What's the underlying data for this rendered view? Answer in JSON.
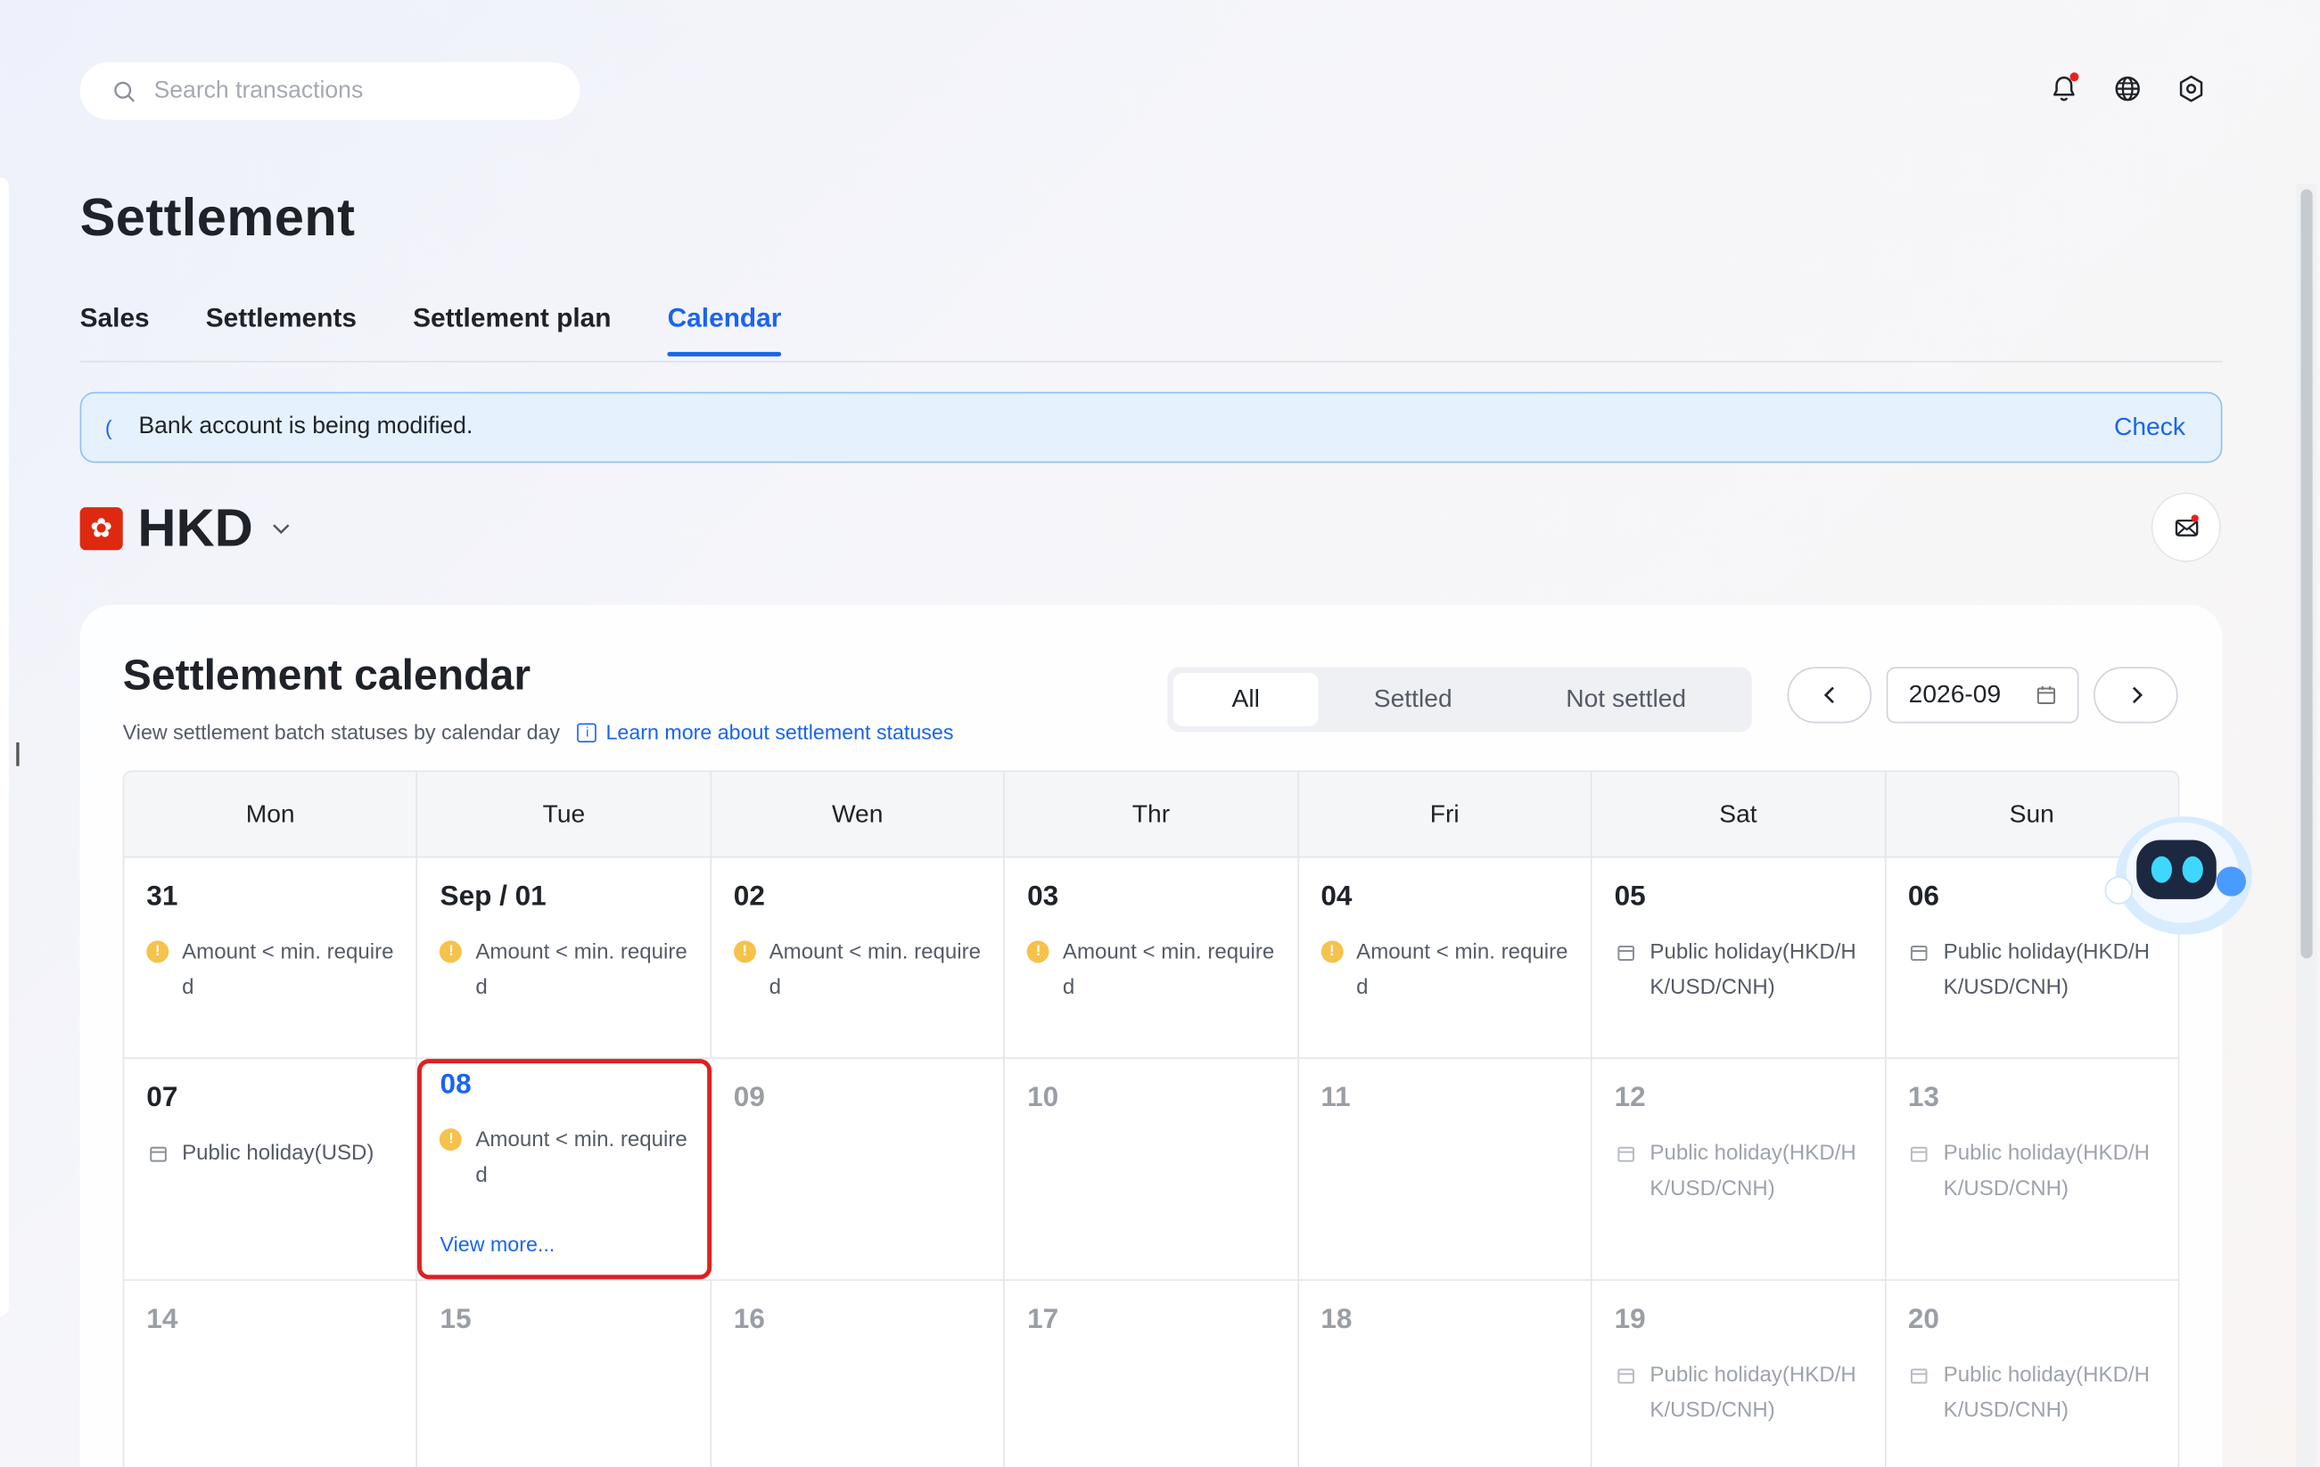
{
  "search": {
    "placeholder": "Search transactions"
  },
  "header": {
    "icons": [
      "bell-icon",
      "globe-icon",
      "settings-icon"
    ],
    "notification_dot_color": "#e5231b"
  },
  "page": {
    "title": "Settlement"
  },
  "tabs": [
    {
      "label": "Sales",
      "active": false
    },
    {
      "label": "Settlements",
      "active": false
    },
    {
      "label": "Settlement plan",
      "active": false
    },
    {
      "label": "Calendar",
      "active": true
    }
  ],
  "banner": {
    "message": "Bank account is being modified.",
    "action": "Check"
  },
  "currency": {
    "code": "HKD",
    "flag": "hk-flag-icon"
  },
  "calendar": {
    "title": "Settlement calendar",
    "subtitle": "View settlement batch statuses by calendar day",
    "learn_more": "Learn more about settlement statuses",
    "filters": {
      "all": "All",
      "settled": "Settled",
      "not_settled": "Not settled",
      "selected": "All"
    },
    "month": "2026-09",
    "weekdays": [
      "Mon",
      "Tue",
      "Wen",
      "Thr",
      "Fri",
      "Sat",
      "Sun"
    ],
    "weeks": [
      [
        {
          "day": "31",
          "status": "Amount < min. require\nd",
          "kind": "warn"
        },
        {
          "day": "Sep / 01",
          "status": "Amount < min. require\nd",
          "kind": "warn"
        },
        {
          "day": "02",
          "status": "Amount < min. require\nd",
          "kind": "warn"
        },
        {
          "day": "03",
          "status": "Amount < min. require\nd",
          "kind": "warn"
        },
        {
          "day": "04",
          "status": "Amount < min. require\nd",
          "kind": "warn"
        },
        {
          "day": "05",
          "status": "Public holiday(HKD/H\nK/USD/CNH)",
          "kind": "holiday"
        },
        {
          "day": "06",
          "status": "Public holiday(HKD/H\nK/USD/CNH)",
          "kind": "holiday"
        }
      ],
      [
        {
          "day": "07",
          "status": "Public holiday(USD)",
          "kind": "holiday"
        },
        {
          "day": "08",
          "status": "Amount < min. require\nd",
          "kind": "warn",
          "selected": true,
          "view_more": "View more..."
        },
        {
          "day": "09",
          "status": "",
          "kind": "none",
          "muted": true
        },
        {
          "day": "10",
          "status": "",
          "kind": "none",
          "muted": true
        },
        {
          "day": "11",
          "status": "",
          "kind": "none",
          "muted": true
        },
        {
          "day": "12",
          "status": "Public holiday(HKD/H\nK/USD/CNH)",
          "kind": "holiday",
          "muted": true
        },
        {
          "day": "13",
          "status": "Public holiday(HKD/H\nK/USD/CNH)",
          "kind": "holiday",
          "muted": true
        }
      ],
      [
        {
          "day": "14",
          "status": "",
          "kind": "none",
          "muted": true
        },
        {
          "day": "15",
          "status": "",
          "kind": "none",
          "muted": true
        },
        {
          "day": "16",
          "status": "",
          "kind": "none",
          "muted": true
        },
        {
          "day": "17",
          "status": "",
          "kind": "none",
          "muted": true
        },
        {
          "day": "18",
          "status": "",
          "kind": "none",
          "muted": true
        },
        {
          "day": "19",
          "status": "Public holiday(HKD/H\nK/USD/CNH)",
          "kind": "holiday",
          "muted": true
        },
        {
          "day": "20",
          "status": "Public holiday(HKD/H\nK/USD/CNH)",
          "kind": "holiday",
          "muted": true
        }
      ]
    ]
  },
  "colors": {
    "accent": "#1a64f0",
    "warning": "#f5c24b",
    "selected_outline": "#e02020"
  },
  "assistant": {
    "icon": "robot-assistant-icon"
  }
}
